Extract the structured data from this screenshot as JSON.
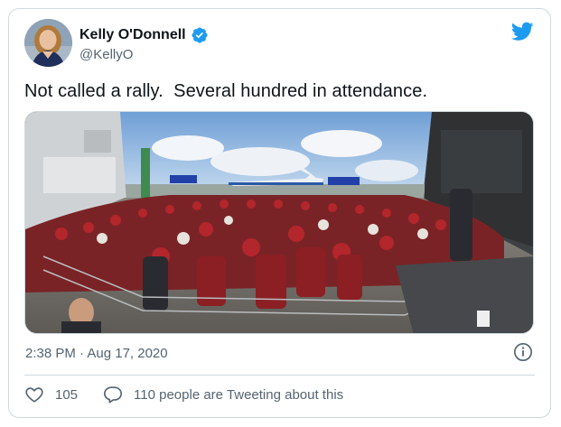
{
  "tweet": {
    "author_name": "Kelly O'Donnell",
    "author_handle": "@KellyO",
    "text": "Not called a rally.  Several hundred in attendance.",
    "timestamp": "2:38 PM · Aug 17, 2020"
  },
  "actions": {
    "like_count": "105",
    "reply_label": "110 people are Tweeting about this"
  },
  "icons": {
    "brand": "twitter-bird-icon",
    "verified": "verified-badge-icon",
    "info": "info-icon",
    "like": "heart-icon",
    "reply": "speech-bubble-icon"
  },
  "colors": {
    "brand_blue": "#1d9bf0",
    "text_primary": "#0f1419",
    "text_secondary": "#536471",
    "border": "#cfd9de"
  }
}
